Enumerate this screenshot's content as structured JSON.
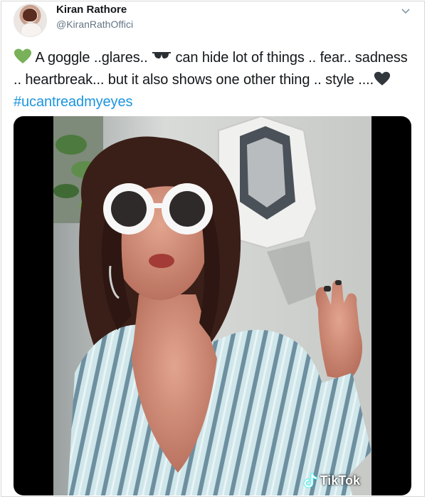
{
  "tweet": {
    "author_name": "Kiran Rathore",
    "author_handle": "@KiranRathOffici",
    "text_part1": " A goggle ..glares.. ",
    "text_part2": " can hide lot of things .. fear.. sadness .. heartbreak... but it also shows one other thing .. style ....",
    "hashtag": "#ucantreadmyeyes",
    "colors": {
      "link": "#1b95e0",
      "secondary": "#657786",
      "primary_text": "#14171a"
    }
  },
  "media": {
    "watermark": "TikTok",
    "icons": [
      "green-heart-icon",
      "sunglasses-icon",
      "black-heart-icon",
      "tiktok-logo-icon",
      "chevron-down-icon"
    ]
  }
}
